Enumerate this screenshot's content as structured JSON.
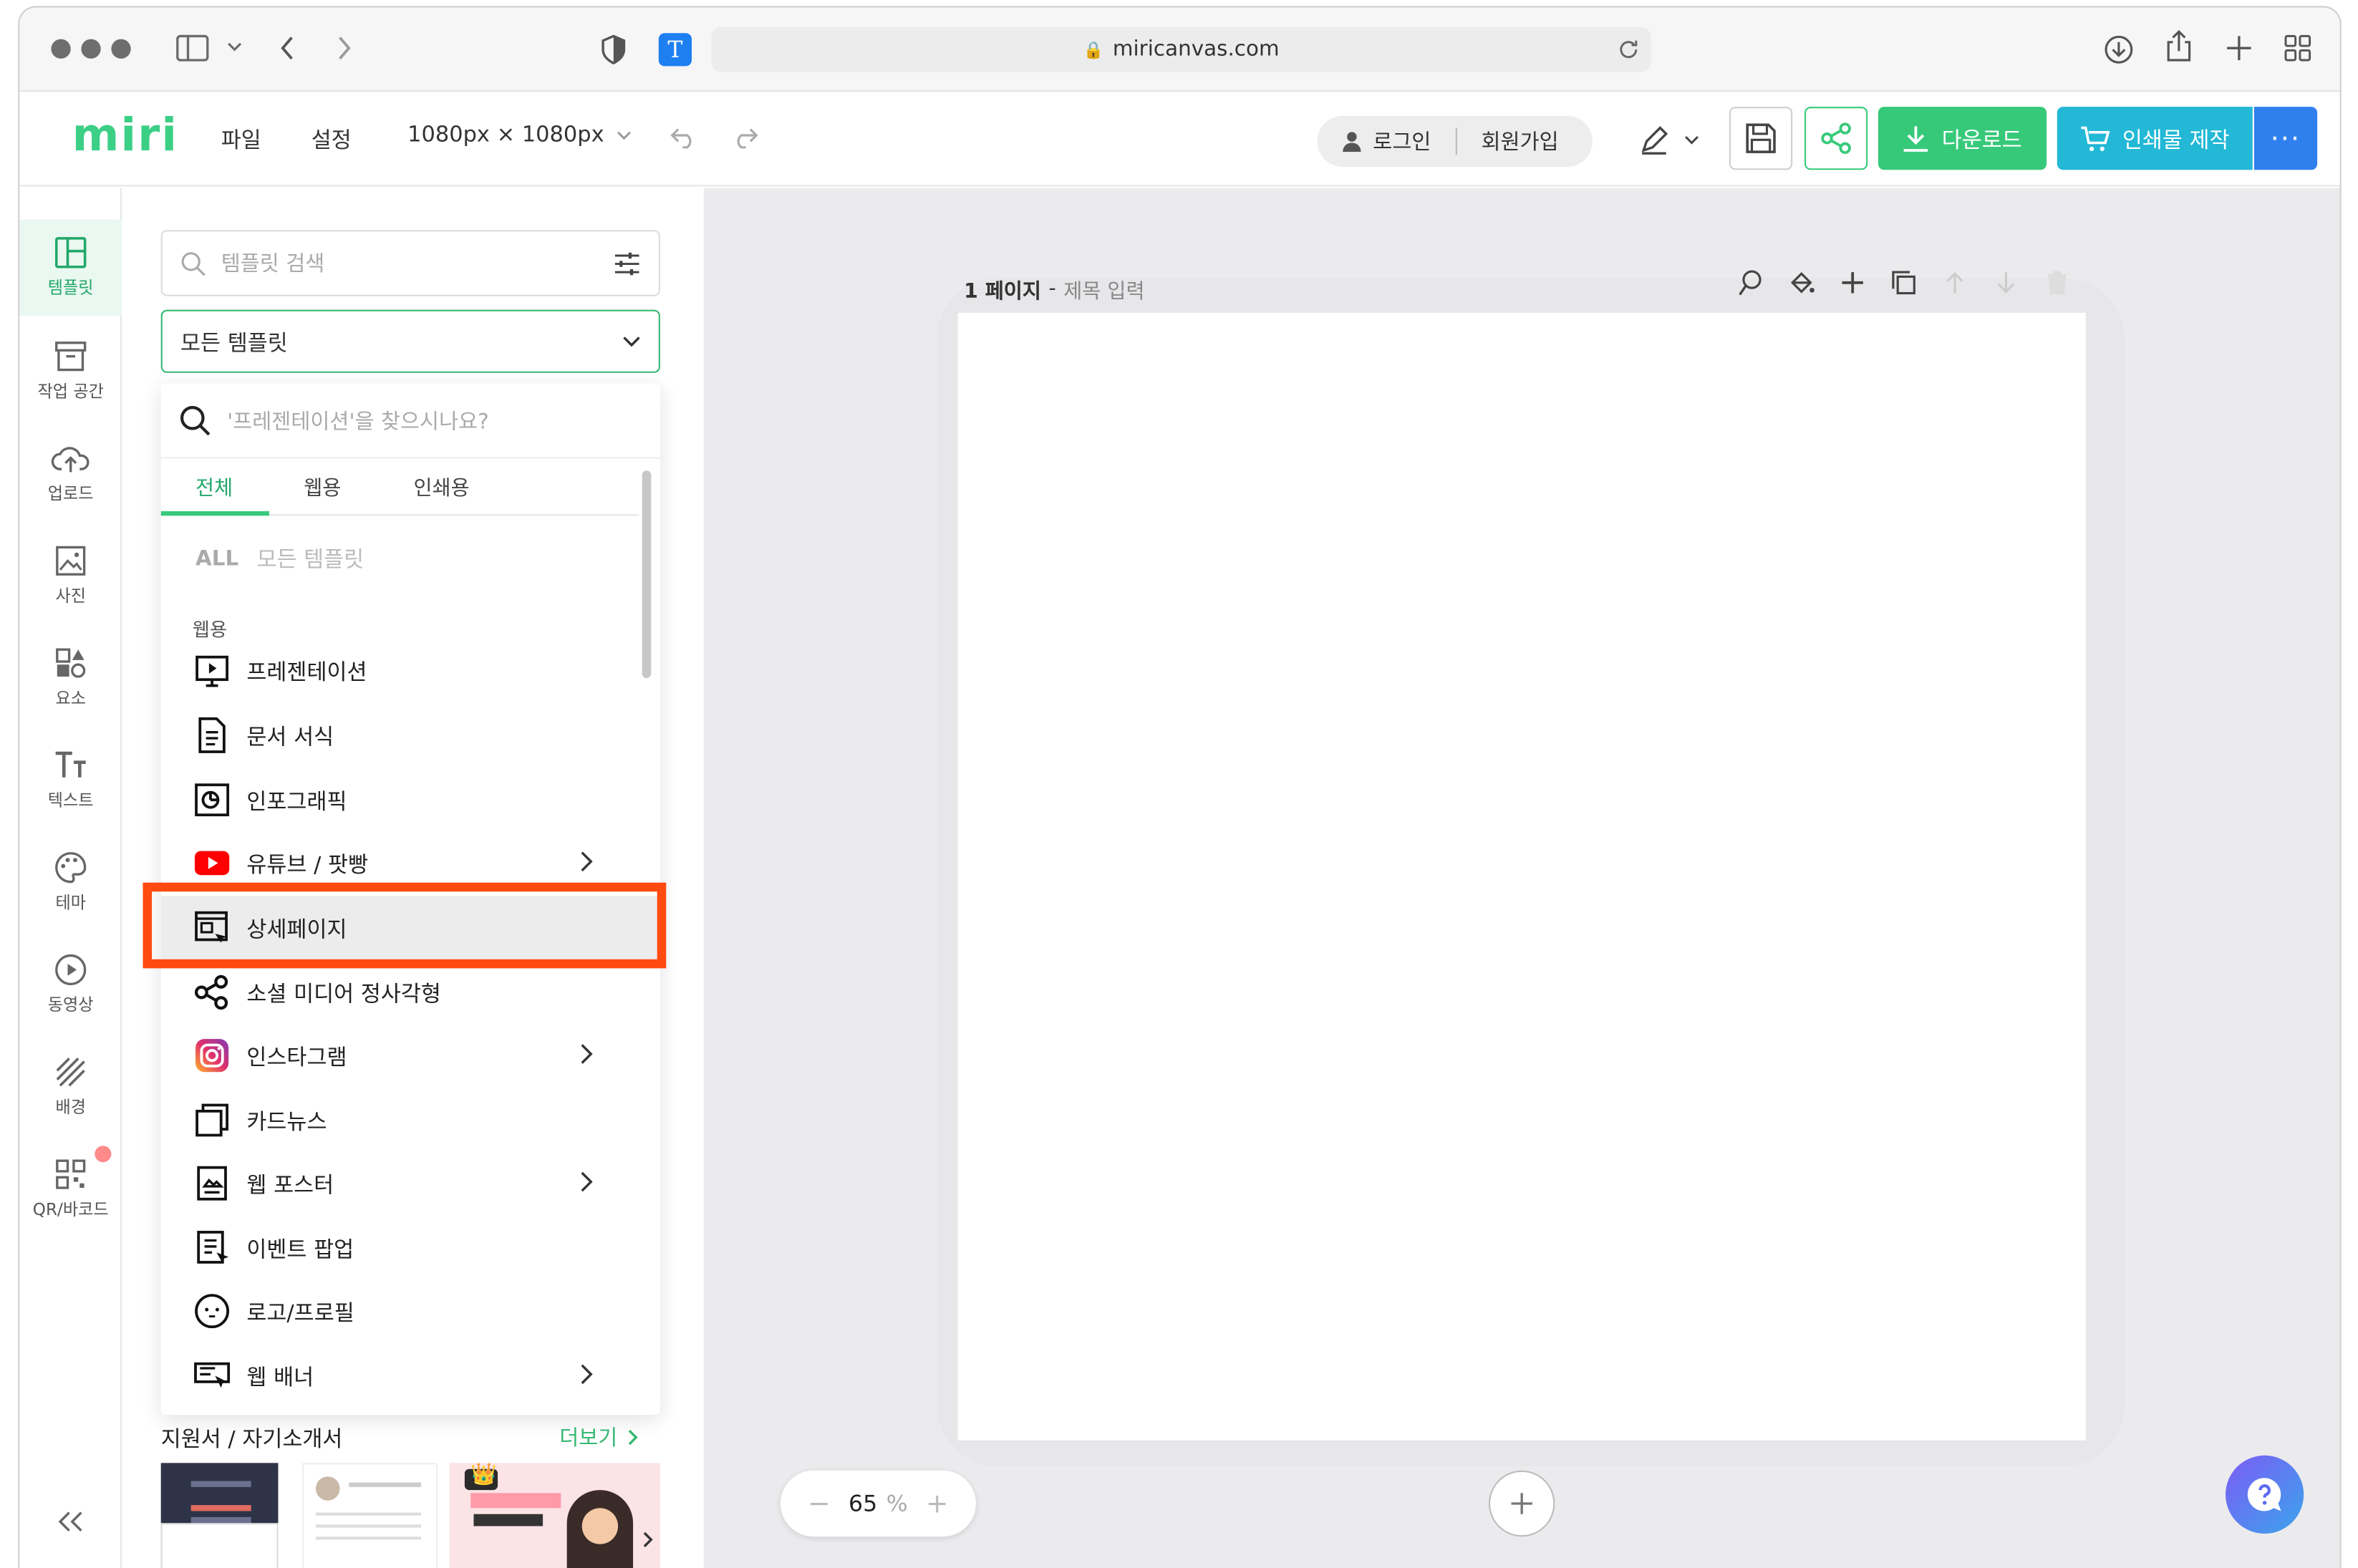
{
  "browser": {
    "url": "miricanvas.com"
  },
  "app": {
    "logo": "miri",
    "menu": [
      "파일",
      "설정"
    ],
    "size_selector": "1080px × 1080px",
    "login": "로그인",
    "signup": "회원가입",
    "download": "다운로드",
    "print": "인쇄물 제작",
    "more": "···"
  },
  "sidebar": [
    {
      "label": "템플릿",
      "icon": "layout-icon",
      "active": true
    },
    {
      "label": "작업 공간",
      "icon": "archive-icon"
    },
    {
      "label": "업로드",
      "icon": "cloud-upload-icon"
    },
    {
      "label": "사진",
      "icon": "image-icon"
    },
    {
      "label": "요소",
      "icon": "shapes-icon"
    },
    {
      "label": "텍스트",
      "icon": "text-icon"
    },
    {
      "label": "테마",
      "icon": "palette-icon"
    },
    {
      "label": "동영상",
      "icon": "play-icon"
    },
    {
      "label": "배경",
      "icon": "background-icon"
    },
    {
      "label": "QR/바코드",
      "icon": "qr-icon"
    }
  ],
  "panel": {
    "search_placeholder": "템플릿 검색",
    "selected_category": "모든 템플릿",
    "dropdown_search_placeholder": "'프레젠테이션'을 찾으시나요?",
    "tabs": [
      "전체",
      "웹용",
      "인쇄용"
    ],
    "active_tab": "전체",
    "all_prefix": "ALL",
    "all_label": "모든 템플릿",
    "section_label": "웹용",
    "items": [
      {
        "label": "프레젠테이션",
        "icon": "presentation-icon",
        "has_submenu": false
      },
      {
        "label": "문서 서식",
        "icon": "document-icon",
        "has_submenu": false
      },
      {
        "label": "인포그래픽",
        "icon": "infographic-icon",
        "has_submenu": false
      },
      {
        "label": "유튜브 / 팟빵",
        "icon": "youtube-icon",
        "has_submenu": true
      },
      {
        "label": "상세페이지",
        "icon": "detail-page-icon",
        "has_submenu": false,
        "highlighted": true
      },
      {
        "label": "소셜 미디어 정사각형",
        "icon": "share-icon",
        "has_submenu": false
      },
      {
        "label": "인스타그램",
        "icon": "instagram-icon",
        "has_submenu": true
      },
      {
        "label": "카드뉴스",
        "icon": "cards-icon",
        "has_submenu": false
      },
      {
        "label": "웹 포스터",
        "icon": "poster-icon",
        "has_submenu": true
      },
      {
        "label": "이벤트 팝업",
        "icon": "popup-icon",
        "has_submenu": false
      },
      {
        "label": "로고/프로필",
        "icon": "logo-icon",
        "has_submenu": false
      },
      {
        "label": "웹 배너",
        "icon": "banner-icon",
        "has_submenu": true
      }
    ],
    "bottom_section_title": "지원서 / 자기소개서",
    "see_more": "더보기"
  },
  "canvas": {
    "page_label": "1 페이지",
    "title_placeholder": "제목 입력",
    "separator": "-",
    "zoom_value": "65",
    "zoom_unit": "%"
  },
  "colors": {
    "brand_green": "#37c97a",
    "print_blue": "#22b8d6",
    "more_blue": "#2f80ed",
    "highlight": "#ff4a10"
  }
}
